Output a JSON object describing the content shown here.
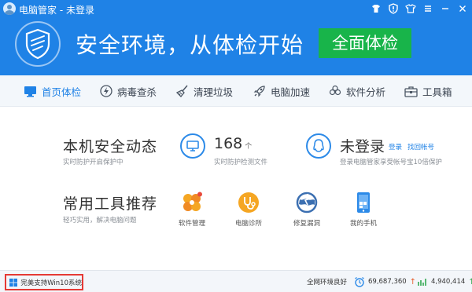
{
  "titlebar": {
    "title": "电脑管家 - 未登录",
    "icons": [
      "avatar",
      "shirt-icon",
      "shield-badge-icon",
      "t-shirt-skin-icon",
      "menu-icon",
      "minimize-icon",
      "close-icon"
    ]
  },
  "banner": {
    "slogan": "安全环境，从体检开始",
    "scan_button": "全面体检",
    "accent": "#1f82e6",
    "button_color": "#18b44a"
  },
  "nav": {
    "items": [
      {
        "label": "首页体检",
        "icon": "monitor-icon",
        "active": true
      },
      {
        "label": "病毒查杀",
        "icon": "lightning-icon",
        "active": false
      },
      {
        "label": "清理垃圾",
        "icon": "broom-icon",
        "active": false
      },
      {
        "label": "电脑加速",
        "icon": "rocket-icon",
        "active": false
      },
      {
        "label": "软件分析",
        "icon": "fan-icon",
        "active": false
      },
      {
        "label": "工具箱",
        "icon": "toolbox-icon",
        "active": false
      }
    ]
  },
  "security": {
    "title": "本机安全动态",
    "subtitle": "实时防护开启保护中",
    "files_count": "168",
    "files_unit": "个",
    "files_caption": "实时防护检测文件",
    "login_status": "未登录",
    "login_link": "登录",
    "find_account_link": "找回帐号",
    "login_caption": "登录电脑管家享受帐号宝10倍保护"
  },
  "tools": {
    "title": "常用工具推荐",
    "subtitle": "轻巧实用，解决电脑问题",
    "items": [
      {
        "label": "软件管理",
        "icon": "software-manager-icon"
      },
      {
        "label": "电脑诊所",
        "icon": "stethoscope-icon"
      },
      {
        "label": "修复漏洞",
        "icon": "patch-globe-icon"
      },
      {
        "label": "我的手机",
        "icon": "phone-icon"
      }
    ]
  },
  "statusbar": {
    "win10_text": "完美支持Win10系统",
    "net_status": "全网环境良好",
    "count1": "69,687,360",
    "count2": "4,940,414"
  }
}
